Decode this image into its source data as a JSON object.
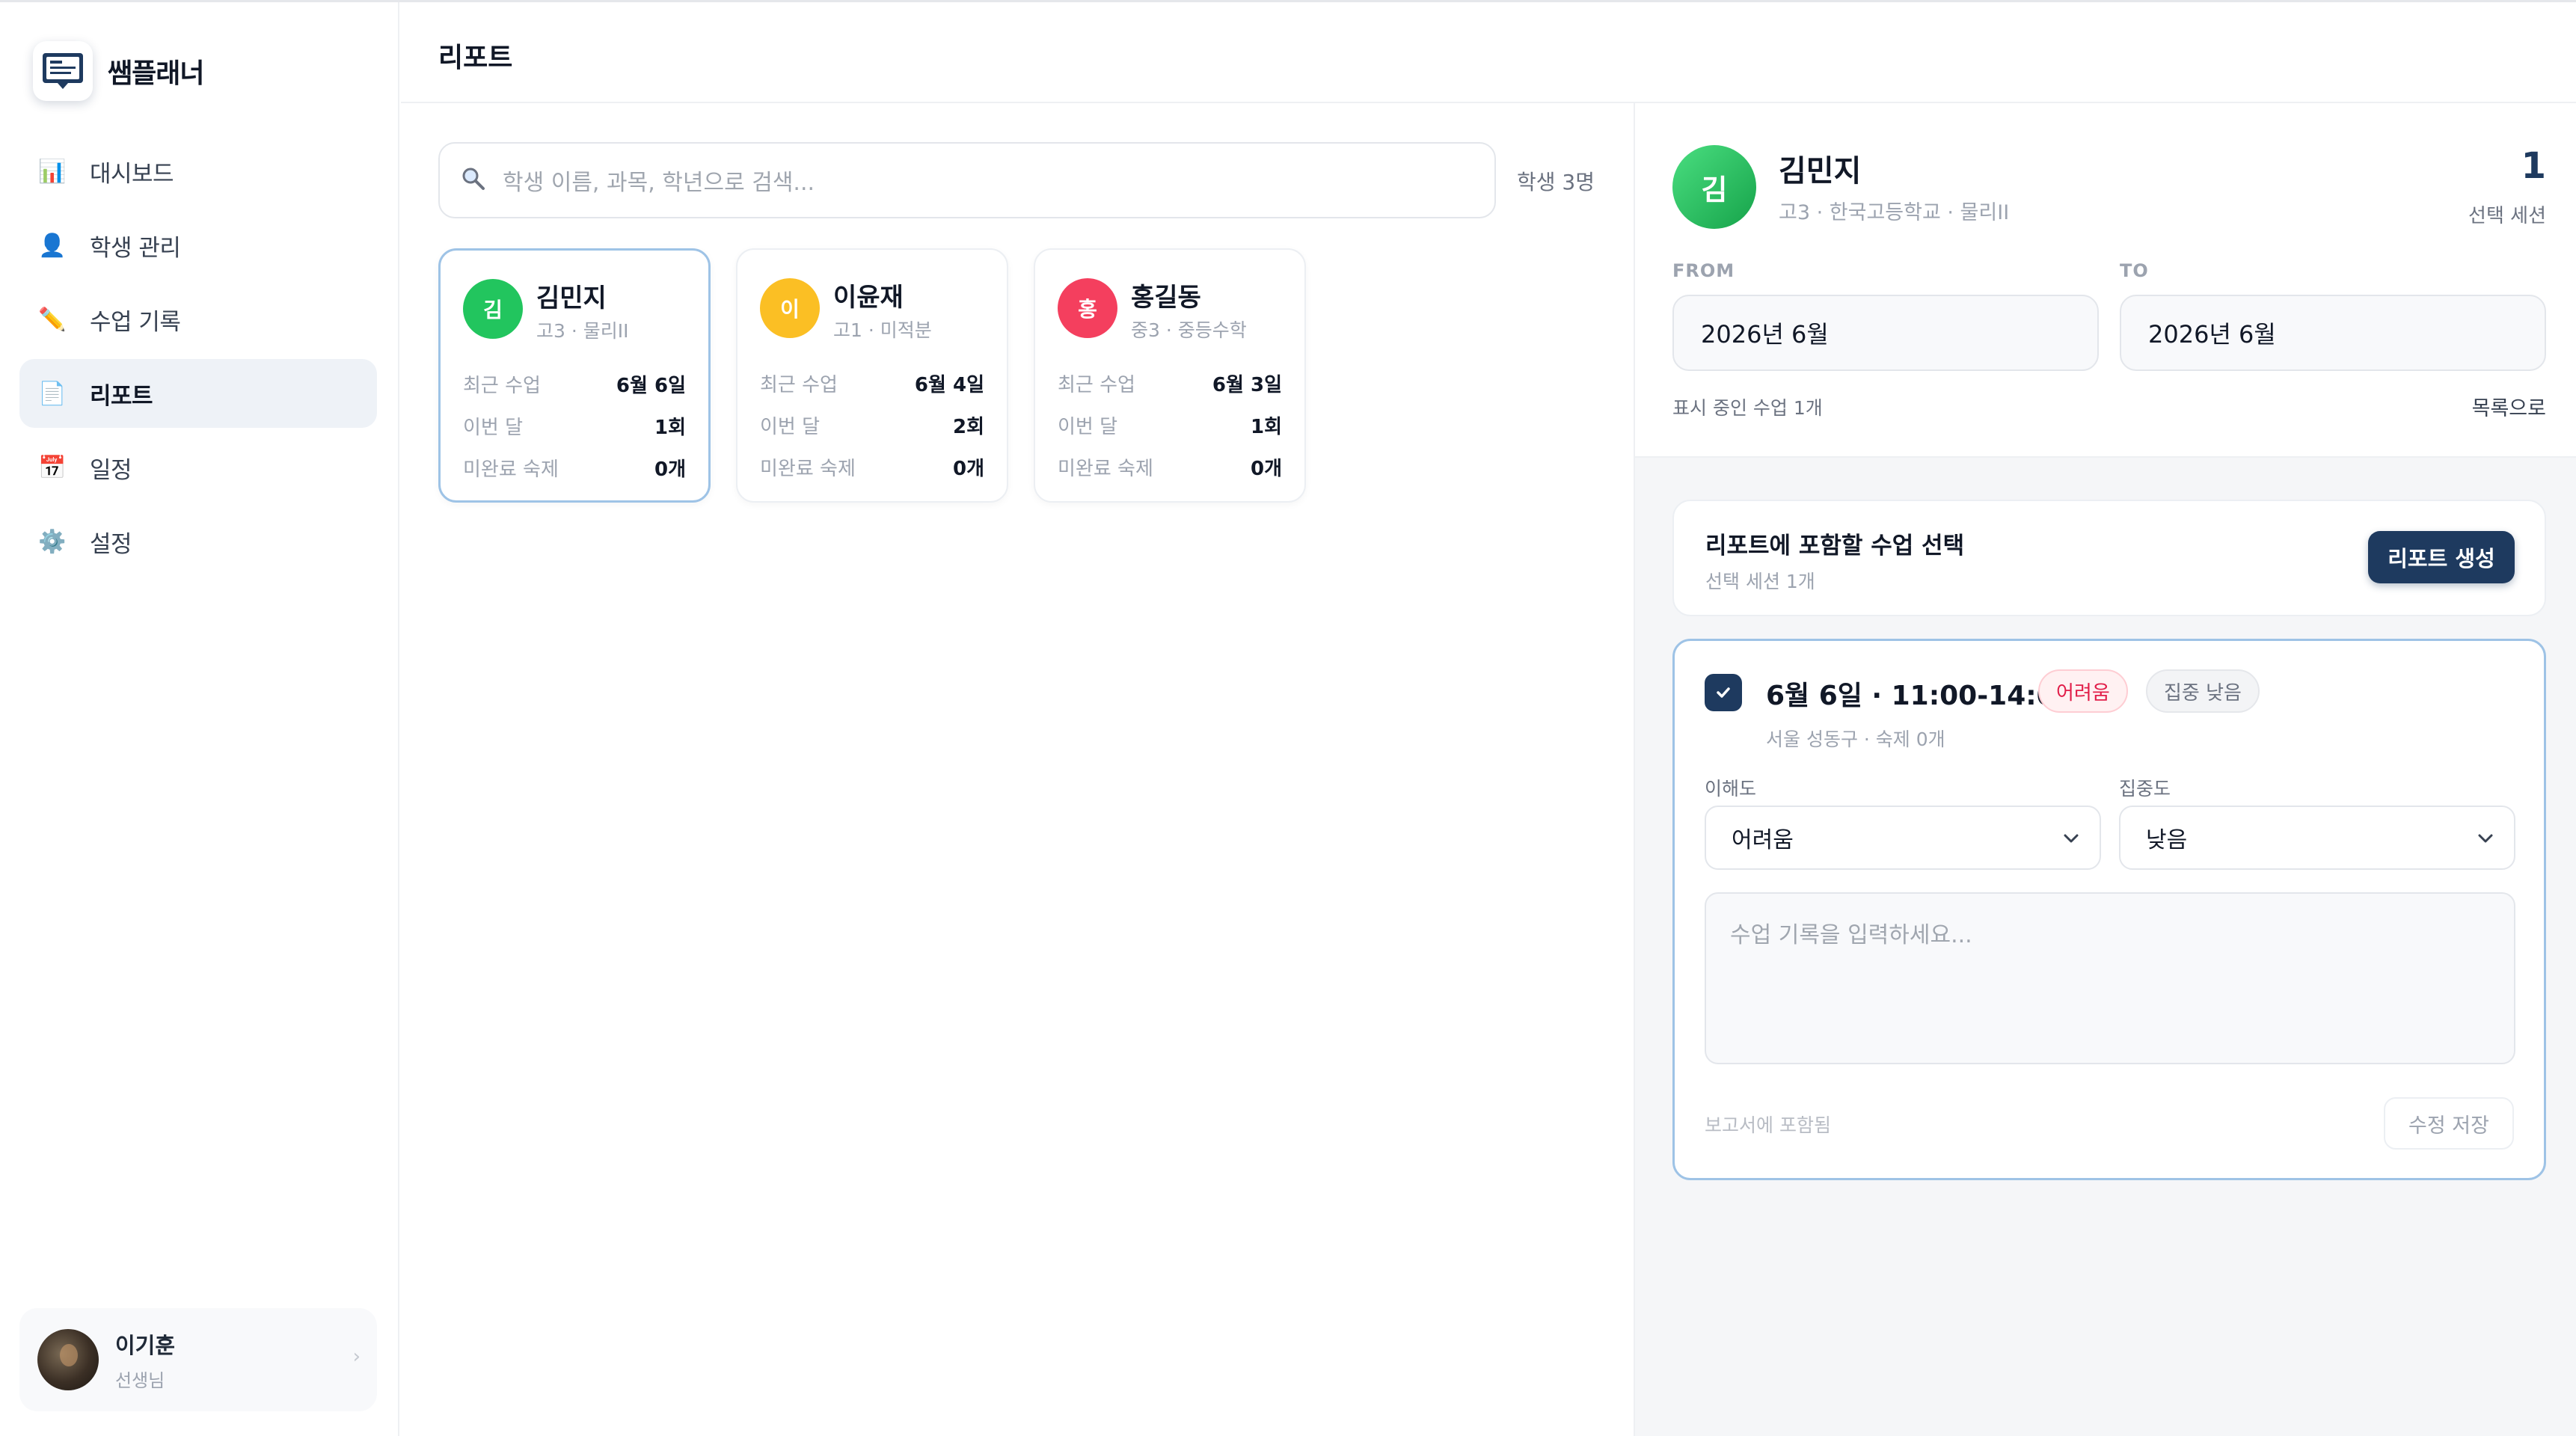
{
  "app": {
    "name": "쌤플래너"
  },
  "sidebar": {
    "items": [
      {
        "label": "대시보드",
        "icon": "bar-chart-icon",
        "glyph": "📊",
        "active": false
      },
      {
        "label": "학생 관리",
        "icon": "person-icon",
        "glyph": "👤",
        "active": false
      },
      {
        "label": "수업 기록",
        "icon": "pencil-icon",
        "glyph": "✏️",
        "active": false
      },
      {
        "label": "리포트",
        "icon": "document-icon",
        "glyph": "📄",
        "active": true
      },
      {
        "label": "일정",
        "icon": "calendar-icon",
        "glyph": "📅",
        "active": false
      },
      {
        "label": "설정",
        "icon": "gear-icon",
        "glyph": "⚙️",
        "active": false
      }
    ],
    "user": {
      "name": "이기훈",
      "role": "선생님"
    }
  },
  "header": {
    "title": "리포트"
  },
  "search": {
    "placeholder": "학생 이름, 과목, 학년으로 검색...",
    "count_label": "학생 3명"
  },
  "students": [
    {
      "initial": "김",
      "name": "김민지",
      "sub": "고3 · 물리II",
      "color": "#22c55e",
      "selected": true,
      "stats": [
        {
          "label": "최근 수업",
          "value": "6월 6일"
        },
        {
          "label": "이번 달",
          "value": "1회"
        },
        {
          "label": "미완료 숙제",
          "value": "0개"
        }
      ]
    },
    {
      "initial": "이",
      "name": "이윤재",
      "sub": "고1 · 미적분",
      "color": "#fbbf24",
      "selected": false,
      "stats": [
        {
          "label": "최근 수업",
          "value": "6월 4일"
        },
        {
          "label": "이번 달",
          "value": "2회"
        },
        {
          "label": "미완료 숙제",
          "value": "0개"
        }
      ]
    },
    {
      "initial": "홍",
      "name": "홍길동",
      "sub": "중3 · 중등수학",
      "color": "#f43f5e",
      "selected": false,
      "stats": [
        {
          "label": "최근 수업",
          "value": "6월 3일"
        },
        {
          "label": "이번 달",
          "value": "1회"
        },
        {
          "label": "미완료 숙제",
          "value": "0개"
        }
      ]
    }
  ],
  "detail": {
    "initial": "김",
    "name": "김민지",
    "sub": "고3 · 한국고등학교 · 물리II",
    "sessions_count": "1",
    "sessions_label": "선택 세션",
    "from_label": "FROM",
    "to_label": "TO",
    "from_value": "2026년 6월",
    "to_value": "2026년 6월",
    "showing": "표시 중인 수업 1개",
    "back_link": "목록으로"
  },
  "report": {
    "title": "리포트에 포함할 수업 선택",
    "subtitle": "선택 세션 1개",
    "generate_label": "리포트 생성"
  },
  "session": {
    "title": "6월 6일 · 11:00-14:00",
    "badge_difficulty": "어려움",
    "badge_focus": "집중 낮음",
    "meta": "서울 성동구 · 숙제 0개",
    "understanding_label": "이해도",
    "understanding_value": "어려움",
    "focus_label": "집중도",
    "focus_value": "낮음",
    "notes_placeholder": "수업 기록을 입력하세요...",
    "included_label": "보고서에 포함됨",
    "save_label": "수정 저장"
  }
}
